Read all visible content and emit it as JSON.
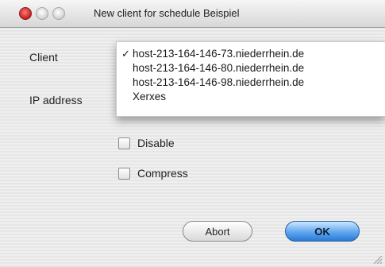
{
  "window": {
    "title": "New client for schedule Beispiel"
  },
  "form": {
    "client_label": "Client",
    "ip_label": "IP address"
  },
  "dropdown": {
    "options": [
      {
        "label": "host-213-164-146-73.niederrhein.de",
        "checked": true
      },
      {
        "label": "host-213-164-146-80.niederrhein.de",
        "checked": false
      },
      {
        "label": "host-213-164-146-98.niederrhein.de",
        "checked": false
      },
      {
        "label": "Xerxes",
        "checked": false
      }
    ],
    "check_mark": "✓"
  },
  "checkboxes": {
    "disable_label": "Disable",
    "compress_label": "Compress"
  },
  "buttons": {
    "abort_label": "Abort",
    "ok_label": "OK"
  }
}
